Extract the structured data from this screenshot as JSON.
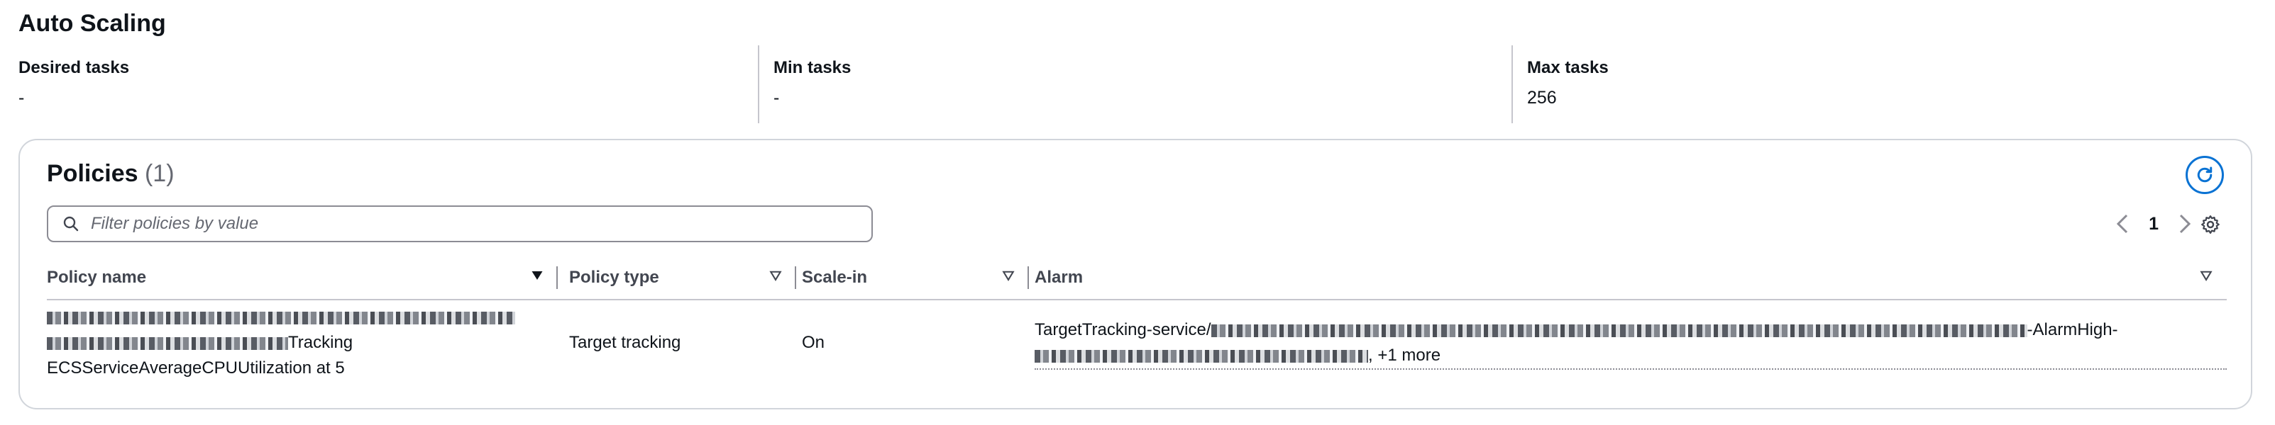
{
  "section_title": "Auto Scaling",
  "metrics": [
    {
      "label": "Desired tasks",
      "value": "-"
    },
    {
      "label": "Min tasks",
      "value": "-"
    },
    {
      "label": "Max tasks",
      "value": "256"
    }
  ],
  "policies": {
    "title": "Policies",
    "count": "(1)",
    "filter_placeholder": "Filter policies by value",
    "page": "1",
    "columns": [
      "Policy name",
      "Policy type",
      "Scale-in",
      "Alarm"
    ],
    "rows": [
      {
        "name_line2_suffix": "Tracking",
        "name_line3": "ECSServiceAverageCPUUtilization at 5",
        "type": "Target tracking",
        "scale_in": "On",
        "alarm_prefix": "TargetTracking-service/",
        "alarm_suffix": "-AlarmHigh-",
        "alarm_more": ", +1 more"
      }
    ]
  },
  "colors": {
    "accent": "#0972d3",
    "border": "#d1d5db",
    "text": "#0f141a",
    "muted": "#656871"
  }
}
